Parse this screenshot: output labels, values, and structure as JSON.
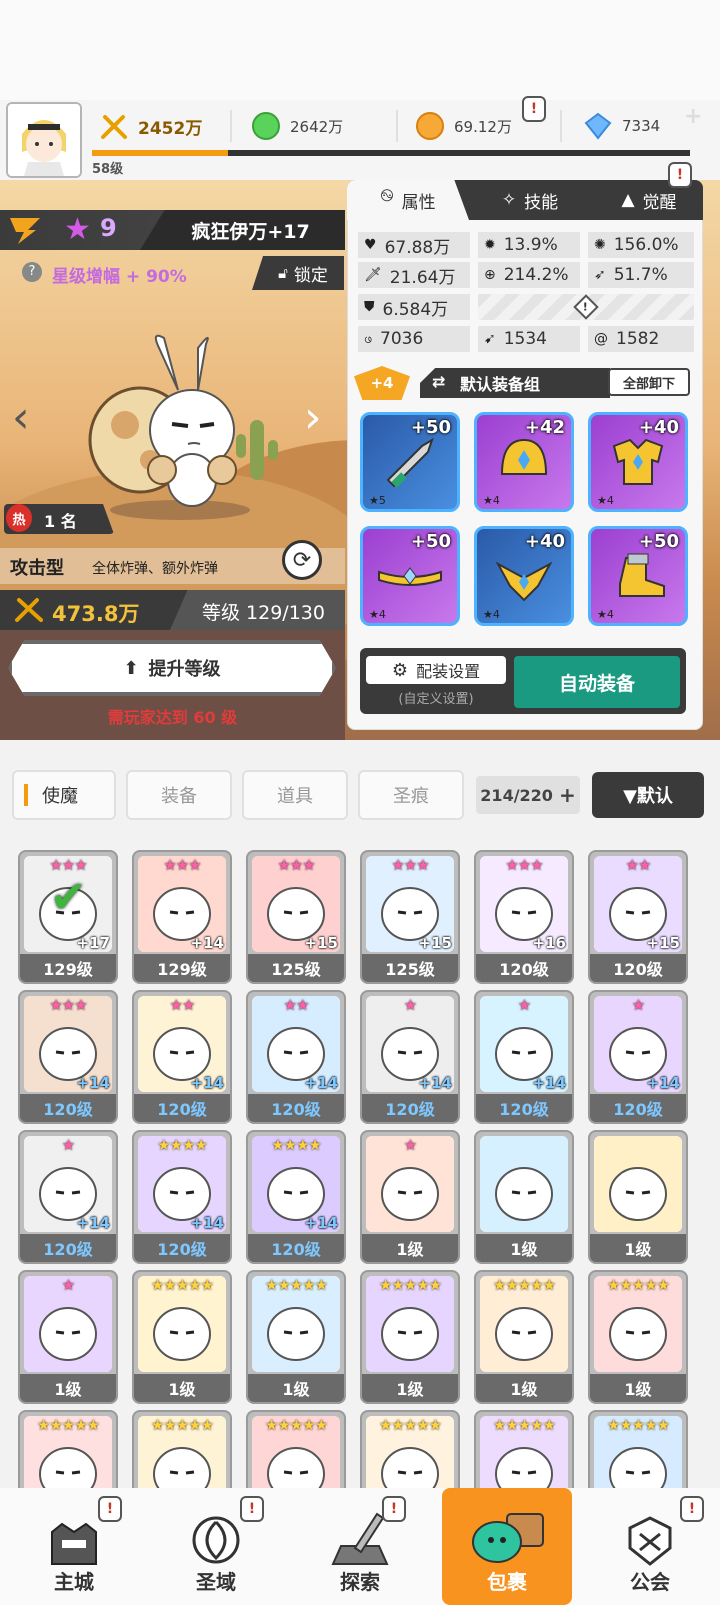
{
  "currency": {
    "power": "2452万",
    "green": "2642万",
    "gold": "69.12万",
    "gem": "7334"
  },
  "player": {
    "level": "58级"
  },
  "hero": {
    "star_count": "9",
    "name": "疯狂伊万+17",
    "star_bonus": "星级增幅 + 90%",
    "lock_label": "锁定",
    "hot_rank": "1 名",
    "hot_label": "热",
    "type_label": "攻击型",
    "type_desc": "全体炸弹、额外炸弹",
    "power": "473.8万",
    "level_label": "等级 129/130",
    "upgrade_label": "提升等级",
    "requirement": "需玩家达到 60 级"
  },
  "panel": {
    "tabs": [
      "属性",
      "技能",
      "觉醒"
    ],
    "stats": [
      {
        "icon": "heart-icon",
        "value": "67.88万"
      },
      {
        "icon": "burst-icon",
        "value": "13.9%"
      },
      {
        "icon": "sun-icon",
        "value": "156.0%"
      },
      {
        "icon": "sword-icon",
        "value": "21.64万"
      },
      {
        "icon": "crosshair-icon",
        "value": "214.2%"
      },
      {
        "icon": "speed-icon",
        "value": "51.7%"
      },
      {
        "icon": "shield-icon",
        "value": "6.584万"
      },
      {
        "icon": "swirl-icon",
        "value": "7036"
      },
      {
        "icon": "bow-icon",
        "value": "1534"
      },
      {
        "icon": "spiral-icon",
        "value": "1582"
      }
    ],
    "equip_bonus": "+4",
    "equip_set": "默认装备组",
    "unequip_all": "全部卸下",
    "equips": [
      {
        "plus": "+50",
        "stars": "★5",
        "icon": "⚔"
      },
      {
        "plus": "+42",
        "stars": "★4",
        "icon": "⛑"
      },
      {
        "plus": "+40",
        "stars": "★4",
        "icon": "🛡"
      },
      {
        "plus": "+50",
        "stars": "★4",
        "icon": "═"
      },
      {
        "plus": "+40",
        "stars": "★4",
        "icon": "✦"
      },
      {
        "plus": "+50",
        "stars": "★4",
        "icon": "👢"
      }
    ],
    "config_label": "配装设置",
    "config_sub": "(自定义设置)",
    "auto_equip": "自动装备"
  },
  "filter_tabs": [
    "使魔",
    "装备",
    "道具",
    "圣痕"
  ],
  "capacity": "214/220",
  "sort_label": "▼默认",
  "cards": [
    {
      "stars": "★★★",
      "gold": false,
      "plus": "+17",
      "level": "129级",
      "blue": false,
      "color": "#f0f0f0"
    },
    {
      "stars": "★★★",
      "gold": false,
      "plus": "+14",
      "level": "129级",
      "blue": false,
      "color": "#ffd9d0"
    },
    {
      "stars": "★★★",
      "gold": false,
      "plus": "+15",
      "level": "125级",
      "blue": false,
      "color": "#ffd0d0"
    },
    {
      "stars": "★★★",
      "gold": false,
      "plus": "+15",
      "level": "125级",
      "blue": false,
      "color": "#e0f0ff"
    },
    {
      "stars": "★★★",
      "gold": false,
      "plus": "+16",
      "level": "120级",
      "blue": false,
      "color": "#f5eaff"
    },
    {
      "stars": "★★",
      "gold": false,
      "plus": "+15",
      "level": "120级",
      "blue": false,
      "color": "#eadcff"
    },
    {
      "stars": "★★★",
      "gold": false,
      "plus": "+14",
      "level": "120级",
      "blue": true,
      "color": "#f5e0d0"
    },
    {
      "stars": "★★",
      "gold": false,
      "plus": "+14",
      "level": "120级",
      "blue": true,
      "color": "#fff3d6"
    },
    {
      "stars": "★★",
      "gold": false,
      "plus": "+14",
      "level": "120级",
      "blue": true,
      "color": "#d6ecff"
    },
    {
      "stars": "★",
      "gold": false,
      "plus": "+14",
      "level": "120级",
      "blue": true,
      "color": "#eeeeee"
    },
    {
      "stars": "★",
      "gold": false,
      "plus": "+14",
      "level": "120级",
      "blue": true,
      "color": "#d6f3ff"
    },
    {
      "stars": "★",
      "gold": false,
      "plus": "+14",
      "level": "120级",
      "blue": true,
      "color": "#e8d6ff"
    },
    {
      "stars": "★",
      "gold": false,
      "plus": "+14",
      "level": "120级",
      "blue": true,
      "color": "#f0f0f0"
    },
    {
      "stars": "★★★★",
      "gold": true,
      "plus": "+14",
      "level": "120级",
      "blue": true,
      "color": "#e6d6ff"
    },
    {
      "stars": "★★★★",
      "gold": true,
      "plus": "+14",
      "level": "120级",
      "blue": true,
      "color": "#dccbff"
    },
    {
      "stars": "★",
      "gold": false,
      "plus": "",
      "level": "1级",
      "blue": false,
      "color": "#ffe3d6"
    },
    {
      "stars": "",
      "gold": false,
      "plus": "",
      "level": "1级",
      "blue": false,
      "color": "#d6f0ff"
    },
    {
      "stars": "",
      "gold": false,
      "plus": "",
      "level": "1级",
      "blue": false,
      "color": "#fff0c8"
    },
    {
      "stars": "★",
      "gold": false,
      "plus": "",
      "level": "1级",
      "blue": false,
      "color": "#e9d6ff"
    },
    {
      "stars": "★★★★★",
      "gold": true,
      "plus": "",
      "level": "1级",
      "blue": false,
      "color": "#fff3d0"
    },
    {
      "stars": "★★★★★",
      "gold": true,
      "plus": "",
      "level": "1级",
      "blue": false,
      "color": "#d9efff"
    },
    {
      "stars": "★★★★★",
      "gold": true,
      "plus": "",
      "level": "1级",
      "blue": false,
      "color": "#e6d6ff"
    },
    {
      "stars": "★★★★★",
      "gold": true,
      "plus": "",
      "level": "1级",
      "blue": false,
      "color": "#ffedd6"
    },
    {
      "stars": "★★★★★",
      "gold": true,
      "plus": "",
      "level": "1级",
      "blue": false,
      "color": "#ffdcdc"
    },
    {
      "stars": "★★★★★",
      "gold": true,
      "plus": "",
      "level": "",
      "blue": false,
      "color": "#ffe0e0"
    },
    {
      "stars": "★★★★★",
      "gold": true,
      "plus": "",
      "level": "",
      "blue": false,
      "color": "#fff3d6"
    },
    {
      "stars": "★★★★★",
      "gold": true,
      "plus": "",
      "level": "",
      "blue": false,
      "color": "#ffd6d6"
    },
    {
      "stars": "★★★★★",
      "gold": true,
      "plus": "",
      "level": "",
      "blue": false,
      "color": "#fff3e0"
    },
    {
      "stars": "★★★★★",
      "gold": true,
      "plus": "",
      "level": "",
      "blue": false,
      "color": "#eedcff"
    },
    {
      "stars": "★★★★★",
      "gold": true,
      "plus": "",
      "level": "",
      "blue": false,
      "color": "#d6ebff"
    }
  ],
  "nav": [
    {
      "label": "主城",
      "icon": "castle-icon"
    },
    {
      "label": "圣域",
      "icon": "vortex-icon"
    },
    {
      "label": "探索",
      "icon": "sword-stone-icon"
    },
    {
      "label": "包裹",
      "icon": "bag-icon"
    },
    {
      "label": "公会",
      "icon": "guild-icon"
    }
  ]
}
